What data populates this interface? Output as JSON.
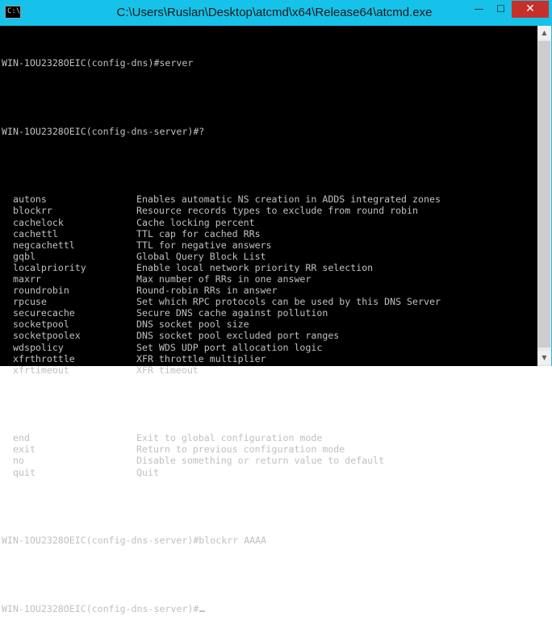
{
  "window": {
    "title": "C:\\Users\\Ruslan\\Desktop\\atcmd\\x64\\Release64\\atcmd.exe",
    "app_icon_text": "C:\\",
    "minimize_glyph": "—",
    "maximize_glyph": "☐",
    "close_glyph": "✕"
  },
  "console": {
    "prompt1": "WIN-1OU2328OEIC(config-dns)#server",
    "prompt2": "WIN-1OU2328OEIC(config-dns-server)#?",
    "commands": [
      {
        "name": "autons",
        "desc": "Enables automatic NS creation in ADDS integrated zones"
      },
      {
        "name": "blockrr",
        "desc": "Resource records types to exclude from round robin"
      },
      {
        "name": "cachelock",
        "desc": "Cache locking percent"
      },
      {
        "name": "cachettl",
        "desc": "TTL cap for cached RRs"
      },
      {
        "name": "negcachettl",
        "desc": "TTL for negative answers"
      },
      {
        "name": "gqbl",
        "desc": "Global Query Block List"
      },
      {
        "name": "localpriority",
        "desc": "Enable local network priority RR selection"
      },
      {
        "name": "maxrr",
        "desc": "Max number of RRs in one answer"
      },
      {
        "name": "roundrobin",
        "desc": "Round-robin RRs in answer"
      },
      {
        "name": "rpcuse",
        "desc": "Set which RPC protocols can be used by this DNS Server"
      },
      {
        "name": "securecache",
        "desc": "Secure DNS cache against pollution"
      },
      {
        "name": "socketpool",
        "desc": "DNS socket pool size"
      },
      {
        "name": "socketpoolex",
        "desc": "DNS socket pool excluded port ranges"
      },
      {
        "name": "wdspolicy",
        "desc": "Set WDS UDP port allocation logic"
      },
      {
        "name": "xfrthrottle",
        "desc": "XFR throttle multiplier"
      },
      {
        "name": "xfrtimeout",
        "desc": "XFR timeout"
      }
    ],
    "global_commands": [
      {
        "name": "end",
        "desc": "Exit to global configuration mode"
      },
      {
        "name": "exit",
        "desc": "Return to previous configuration mode"
      },
      {
        "name": "no",
        "desc": "Disable something or return value to default"
      },
      {
        "name": "quit",
        "desc": "Quit"
      }
    ],
    "prompt3": "WIN-1OU2328OEIC(config-dns-server)#blockrr AAAA",
    "prompt4": "WIN-1OU2328OEIC(config-dns-server)#"
  },
  "scrollbar": {
    "up_glyph": "▲",
    "down_glyph": "▼"
  }
}
